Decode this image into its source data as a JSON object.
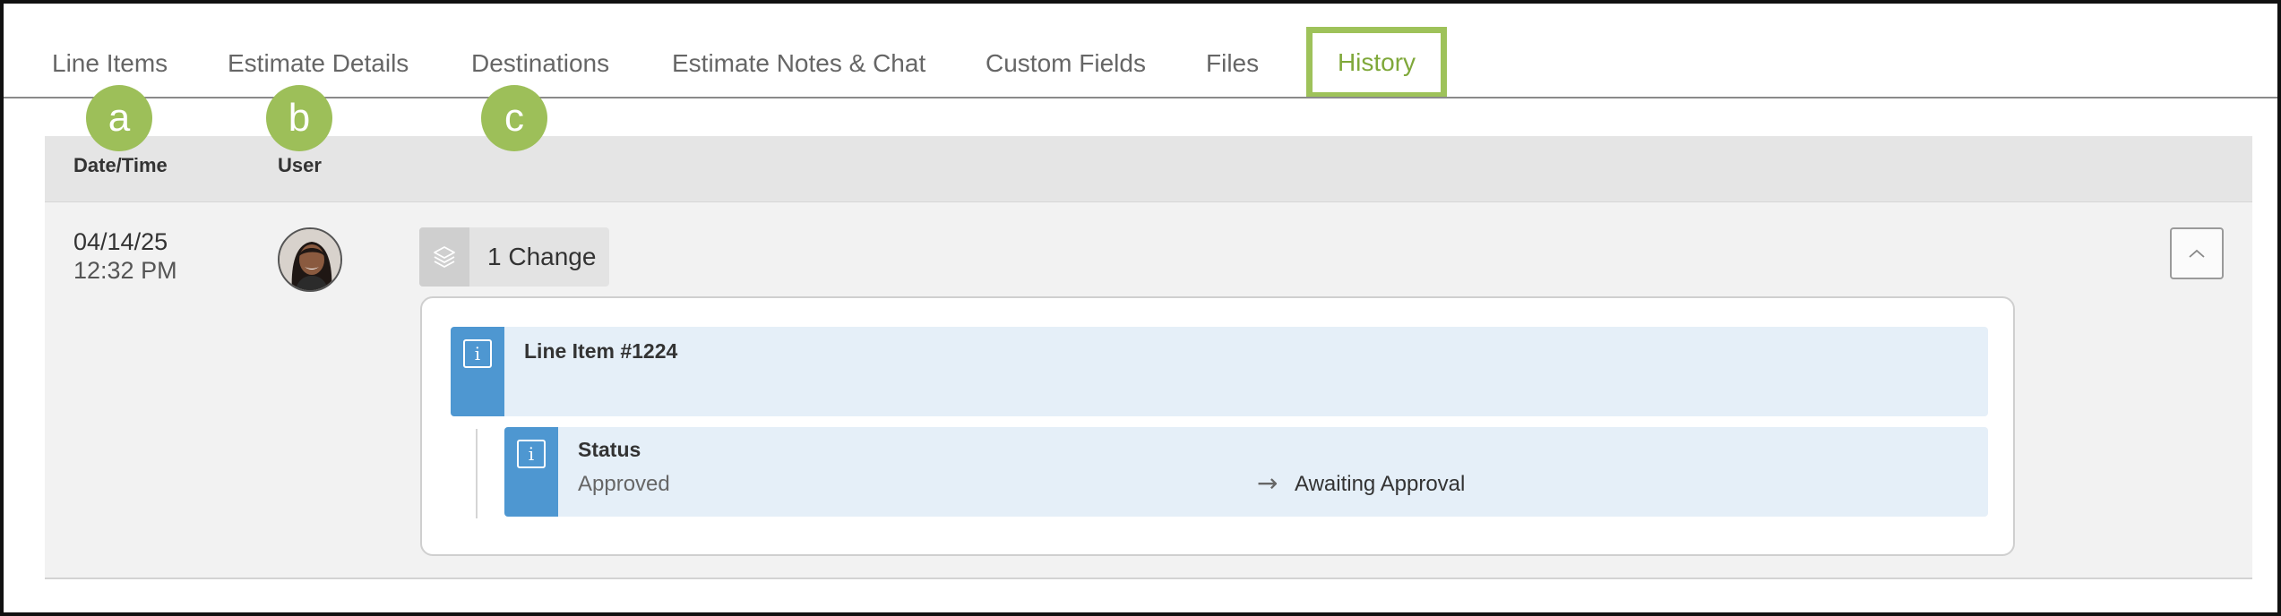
{
  "tabs": [
    {
      "label": "Line Items"
    },
    {
      "label": "Estimate Details"
    },
    {
      "label": "Destinations"
    },
    {
      "label": "Estimate Notes & Chat"
    },
    {
      "label": "Custom Fields"
    },
    {
      "label": "Files"
    },
    {
      "label": "History",
      "active": true
    }
  ],
  "callouts": [
    "a",
    "b",
    "c"
  ],
  "table": {
    "columns": [
      "Date/Time",
      "User"
    ]
  },
  "row": {
    "date": "04/14/25",
    "time": "12:32 PM",
    "change_label": "1 Change",
    "line_item": "Line Item #1224",
    "field": "Status",
    "old_value": "Approved",
    "new_value": "Awaiting Approval"
  },
  "colors": {
    "accent_green": "#9dbf59",
    "info_blue": "#4e97d1",
    "info_bg": "#e5eff8"
  }
}
